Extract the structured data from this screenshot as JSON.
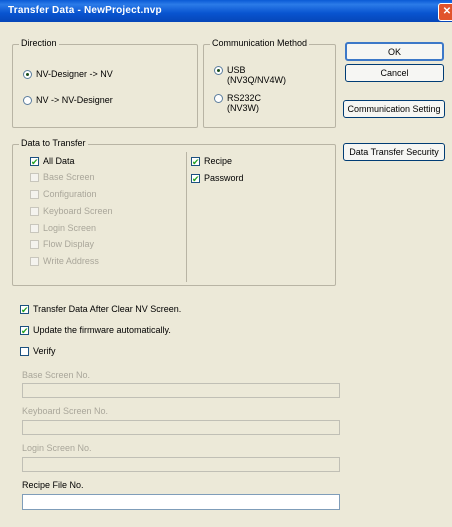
{
  "window": {
    "title": "Transfer Data - NewProject.nvp",
    "close_glyph": "✕"
  },
  "direction": {
    "legend": "Direction",
    "options": [
      "NV-Designer -> NV",
      "NV -> NV-Designer"
    ],
    "selected": 0
  },
  "comm": {
    "legend": "Communication Method",
    "usb_line1": "USB",
    "usb_line2": "(NV3Q/NV4W)",
    "rs_line1": "RS232C",
    "rs_line2": "(NV3W)",
    "selected": "USB"
  },
  "buttons": {
    "ok": "OK",
    "cancel": "Cancel",
    "comm_setting": "Communication Setting",
    "security": "Data Transfer Security"
  },
  "data_to_transfer": {
    "legend": "Data to Transfer",
    "left": [
      {
        "label": "All Data",
        "checked": true,
        "enabled": true
      },
      {
        "label": "Base Screen",
        "checked": false,
        "enabled": false
      },
      {
        "label": "Configuration",
        "checked": false,
        "enabled": false
      },
      {
        "label": "Keyboard Screen",
        "checked": false,
        "enabled": false
      },
      {
        "label": "Login Screen",
        "checked": false,
        "enabled": false
      },
      {
        "label": "Flow Display",
        "checked": false,
        "enabled": false
      },
      {
        "label": "Write Address",
        "checked": false,
        "enabled": false
      }
    ],
    "right": [
      {
        "label": "Recipe",
        "checked": true,
        "enabled": true
      },
      {
        "label": "Password",
        "checked": true,
        "enabled": true
      }
    ]
  },
  "options": {
    "clear_screen": "Transfer Data After Clear NV Screen.",
    "update_fw": "Update the firmware automatically.",
    "verify": "Verify"
  },
  "fields": {
    "base": "Base Screen No.",
    "keyboard": "Keyboard Screen No.",
    "login": "Login Screen No.",
    "recipe": "Recipe File No."
  },
  "check_glyph": "✔"
}
